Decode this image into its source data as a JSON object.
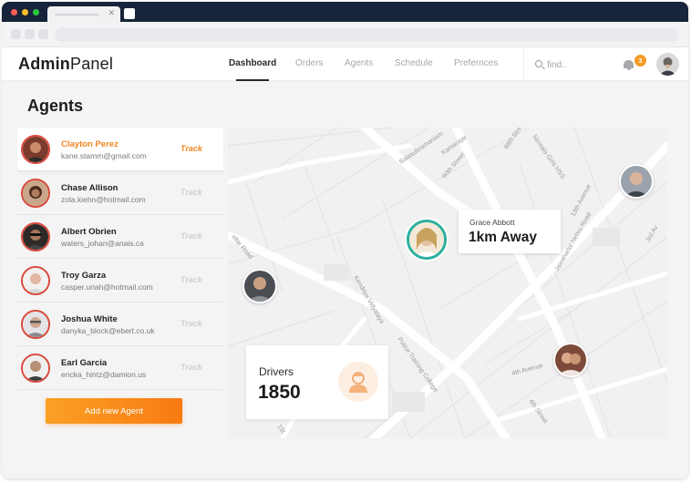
{
  "app": {
    "logo_bold": "Admin",
    "logo_rest": "Panel"
  },
  "nav": {
    "items": [
      {
        "label": "Dashboard",
        "active": true
      },
      {
        "label": "Orders",
        "active": false
      },
      {
        "label": "Agents",
        "active": false
      },
      {
        "label": "Schedule",
        "active": false
      },
      {
        "label": "Prefernces",
        "active": false
      }
    ]
  },
  "search": {
    "placeholder": "find.."
  },
  "notifications": {
    "count": "3"
  },
  "page": {
    "title": "Agents"
  },
  "agents": [
    {
      "name": "Clayton Perez",
      "email": "kane.stamm@gmail.com",
      "action": "Track",
      "selected": true
    },
    {
      "name": "Chase Allison",
      "email": "zola.kiehn@hotmail.com",
      "action": "Track",
      "selected": false
    },
    {
      "name": "Albert Obrien",
      "email": "waters_johan@anais.ca",
      "action": "Track",
      "selected": false
    },
    {
      "name": "Troy Garza",
      "email": "casper.uriah@hotmail.com",
      "action": "Track",
      "selected": false
    },
    {
      "name": "Joshua White",
      "email": "danyka_block@ebert.co.uk",
      "action": "Track",
      "selected": false
    },
    {
      "name": "Earl Garcia",
      "email": "ericka_hintz@damion.us",
      "action": "Track",
      "selected": false
    }
  ],
  "add_agent": {
    "label": "Add new Agent"
  },
  "map": {
    "callout": {
      "name": "Grace Abbott",
      "distance": "1km Away"
    },
    "streets": [
      "Balasubramaniam",
      "Kamarajar",
      "80th Street",
      "88th Street",
      "Nirmala Girls HSS",
      "13th Avenue",
      "Jawaharlal Nehru Road",
      "3rd Av",
      "Kendriya Vidyalaya",
      "Police Training College",
      "4th Avenue",
      "4th Street",
      "ellar Road",
      "15t"
    ]
  },
  "drivers": {
    "label": "Drivers",
    "count": "1850"
  },
  "colors": {
    "accent": "#f0861f",
    "teal": "#2bb09f",
    "header_bar": "#17243a"
  }
}
